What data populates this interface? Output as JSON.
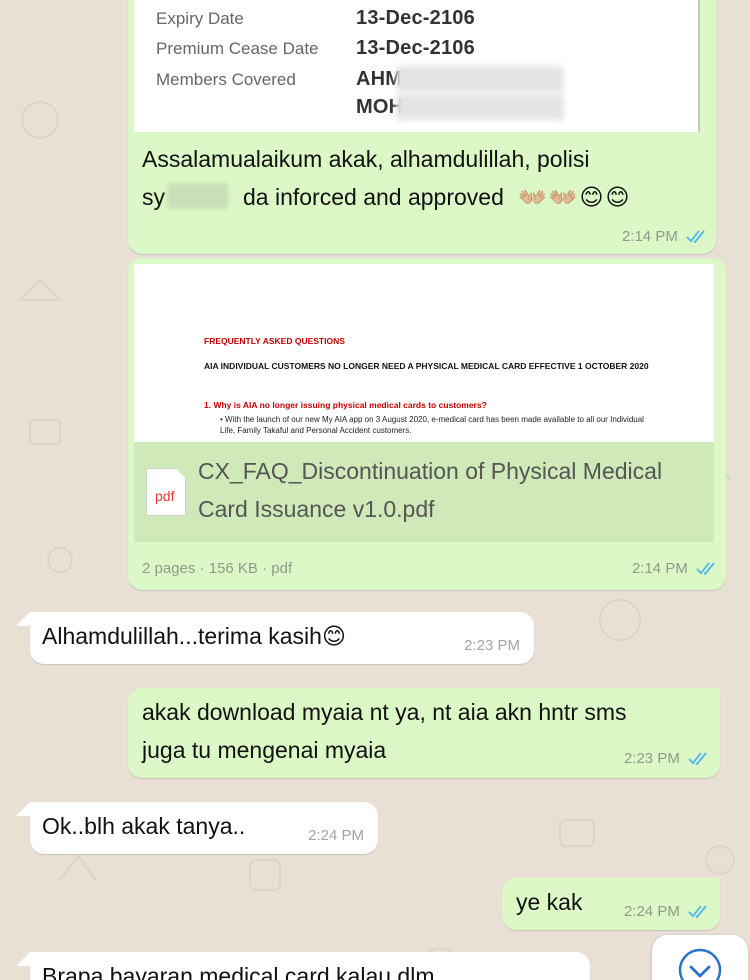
{
  "policy_card": {
    "rows": [
      {
        "key": "Expiry Date",
        "value": "13-Dec-2106"
      },
      {
        "key": "Premium Cease Date",
        "value": "13-Dec-2106"
      },
      {
        "key": "Members Covered",
        "value": "AHM"
      },
      {
        "key": "",
        "value": "MOH"
      }
    ]
  },
  "messages": {
    "m1": {
      "line1": "Assalamualaikum akak, alhamdulillah, polisi",
      "line2a": "sy",
      "line2b": "da inforced and approved",
      "emoji": "👐🏼👐🏼😊😊",
      "time": "2:14 PM"
    },
    "doc": {
      "preview_heading": "FREQUENTLY ASKED QUESTIONS",
      "preview_title": "AIA INDIVIDUAL CUSTOMERS NO LONGER NEED A PHYSICAL MEDICAL CARD EFFECTIVE 1 OCTOBER 2020",
      "preview_question": "1.  Why is AIA no longer issuing physical medical cards to customers?",
      "preview_body": "With the launch of our new My AIA app on 3 August 2020, e-medical card has been made available to all our Individual Life, Family Takaful and Personal Accident customers.",
      "icon_label": "pdf",
      "file_name": "CX_FAQ_Discontinuation of Physical Medical Card Issuance v1.0.pdf",
      "pages": "2 pages",
      "size": "156 KB",
      "ext": "pdf",
      "sep": "·",
      "time": "2:14 PM"
    },
    "m2": {
      "text": "Alhamdulillah...terima kasih😊",
      "time": "2:23 PM"
    },
    "m3": {
      "line1": "akak download myaia nt ya, nt aia akn  hntr sms",
      "line2": "juga tu mengenai myaia",
      "time": "2:23 PM"
    },
    "m4": {
      "text": "Ok..blh akak tanya..",
      "time": "2:24 PM"
    },
    "m5": {
      "text": "ye kak",
      "time": "2:24 PM"
    },
    "m6": {
      "text": "Brapa bayaran medical card kalau dlm"
    }
  },
  "colors": {
    "outgoing": "#dcf8c6",
    "incoming": "#ffffff",
    "read_ticks": "#4fb6ec",
    "wallpaper": "#e8dfd5"
  },
  "icons": {
    "read_receipt": "double-check-icon",
    "scroll_down": "chevron-down-icon",
    "file": "pdf-file-icon"
  }
}
